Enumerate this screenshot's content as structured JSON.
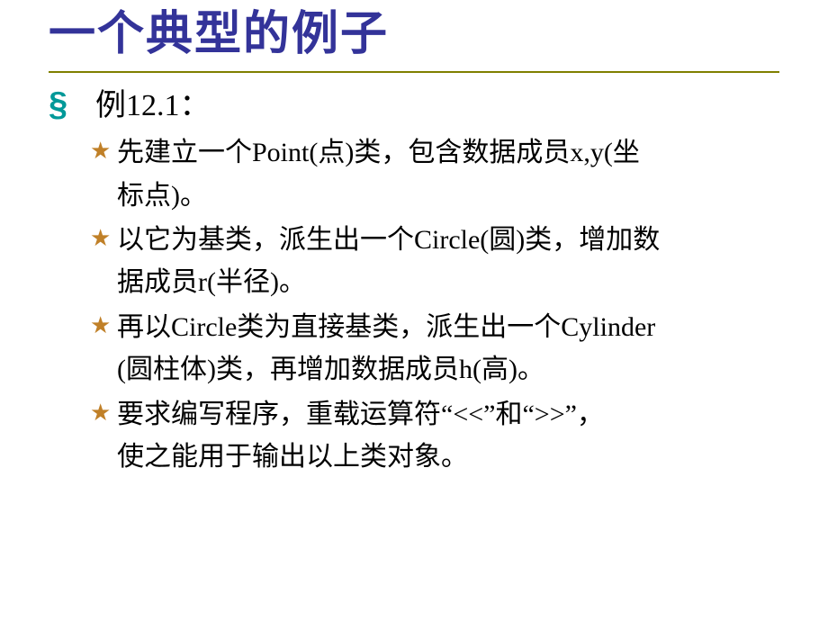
{
  "title": "一个典型的例子",
  "section_marker": "§",
  "section_label": "例12.1：",
  "bullets": [
    {
      "lines": [
        " 先建立一个Point(点)类，包含数据成员x,y(坐",
        "标点)。"
      ]
    },
    {
      "lines": [
        "以它为基类，派生出一个Circle(圆)类，增加数",
        "据成员r(半径)。"
      ]
    },
    {
      "lines": [
        "再以Circle类为直接基类，派生出一个Cylinder",
        "(圆柱体)类，再增加数据成员h(高)。"
      ]
    },
    {
      "lines": [
        "要求编写程序，重载运算符“<<”和“>>”，",
        "使之能用于输出以上类对象。"
      ]
    }
  ],
  "star_glyph": "★"
}
